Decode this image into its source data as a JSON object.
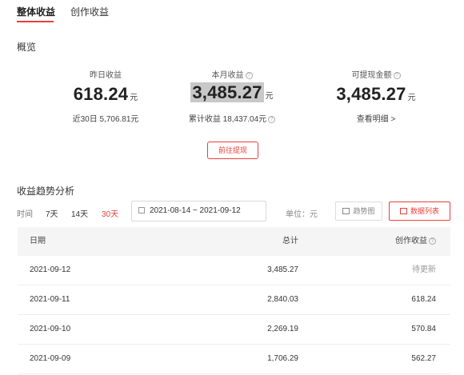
{
  "tabs": [
    {
      "label": "整体收益",
      "active": true
    },
    {
      "label": "创作收益",
      "active": false
    }
  ],
  "overview": {
    "title": "概览",
    "yesterday": {
      "label": "昨日收益",
      "value": "618.24",
      "unit": "元",
      "sub": "近30日 5,706.81元"
    },
    "month": {
      "label": "本月收益",
      "value": "3,485.27",
      "unit": "元",
      "sub": "累计收益 18,437.04元"
    },
    "withdrawable": {
      "label": "可提现金额",
      "value": "3,485.27",
      "unit": "元",
      "sub": "查看明细 >"
    },
    "withdraw_button": "前往提现"
  },
  "trend": {
    "title": "收益趋势分析",
    "time_label": "时间",
    "ranges": [
      {
        "label": "7天",
        "active": false
      },
      {
        "label": "14天",
        "active": false
      },
      {
        "label": "30天",
        "active": true
      }
    ],
    "date_range": "2021-08-14 ~ 2021-09-12",
    "unit_label": "单位：元",
    "views": [
      {
        "label": "趋势图",
        "active": false,
        "icon": "line-chart-icon"
      },
      {
        "label": "数据列表",
        "active": true,
        "icon": "table-icon"
      }
    ]
  },
  "table": {
    "headers": {
      "date": "日期",
      "total": "总计",
      "create": "创作收益"
    },
    "rows": [
      {
        "date": "2021-09-12",
        "total": "3,485.27",
        "create": "待更新"
      },
      {
        "date": "2021-09-11",
        "total": "2,840.03",
        "create": "618.24"
      },
      {
        "date": "2021-09-10",
        "total": "2,269.19",
        "create": "570.84"
      },
      {
        "date": "2021-09-09",
        "total": "1,706.29",
        "create": "562.27"
      }
    ]
  },
  "colors": {
    "accent": "#e8403a",
    "header_bg": "#f5f5f5"
  }
}
